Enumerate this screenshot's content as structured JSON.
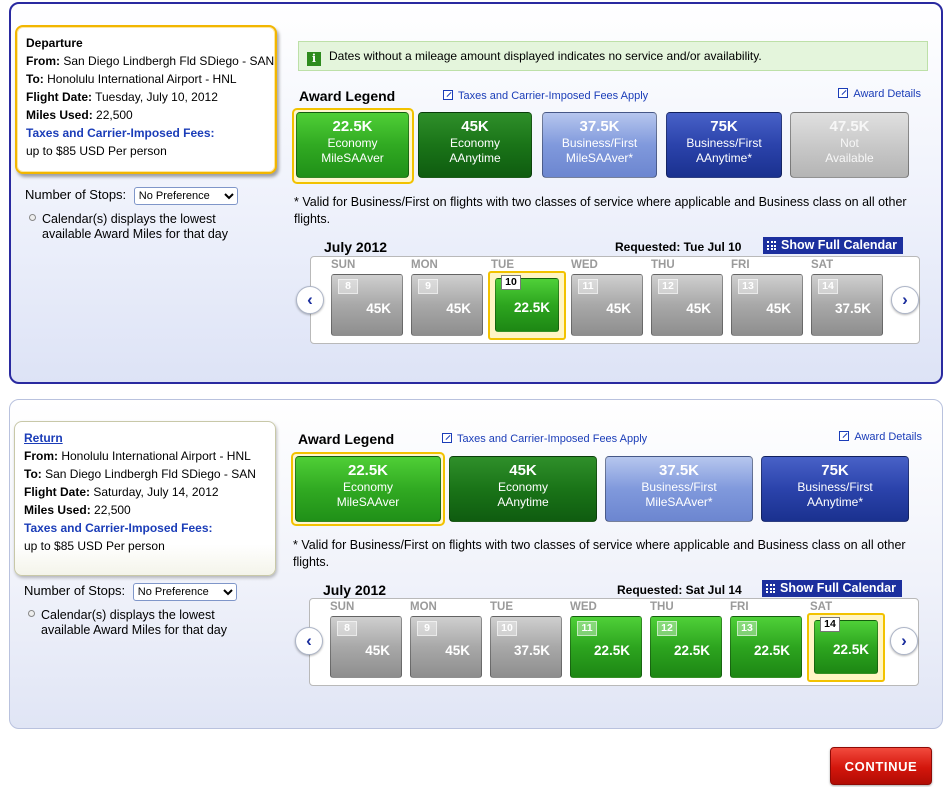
{
  "colors": {
    "section_border": "#2a2aa0",
    "selected_outline": "#f2c200",
    "economy_saver": "#31aa22",
    "economy_anytime": "#1a7418",
    "business_saver": "#8099dc",
    "business_anytime": "#2b43ab",
    "not_available": "#c9c9c9",
    "continue_button": "#d3160c",
    "link": "#1b3db8"
  },
  "departure": {
    "heading": "Departure",
    "from_label": "From:",
    "from_value": "San Diego Lindbergh Fld SDiego - SAN",
    "to_label": "To:",
    "to_value": "Honolulu International Airport - HNL",
    "date_label": "Flight Date:",
    "date_value": "Tuesday, July 10, 2012",
    "miles_label": "Miles Used:",
    "miles_value": "22,500",
    "fees_label": "Taxes and Carrier-Imposed Fees:",
    "fees_value": "up to $85 USD Per person",
    "stops_label": "Number of Stops:",
    "stops_value": "No Preference",
    "cal_note": "Calendar(s) displays the lowest available Award Miles for that day",
    "notice": "Dates without a mileage amount displayed indicates no service and/or availability.",
    "legend_title": "Award Legend",
    "fees_link": "Taxes and Carrier-Imposed Fees Apply",
    "award_details": "Award Details",
    "legend": [
      {
        "value": "22.5K",
        "l1": "Economy",
        "l2": "MileSAAver"
      },
      {
        "value": "45K",
        "l1": "Economy",
        "l2": "AAnytime"
      },
      {
        "value": "37.5K",
        "l1": "Business/First",
        "l2": "MileSAAver*"
      },
      {
        "value": "75K",
        "l1": "Business/First",
        "l2": "AAnytime*"
      },
      {
        "value": "47.5K",
        "l1": "Not",
        "l2": "Available"
      }
    ],
    "footnote": "* Valid for Business/First on flights with two classes of service where applicable and Business class on all other flights.",
    "month": "July 2012",
    "requested": "Requested: Tue Jul 10",
    "full_calendar": "Show Full Calendar",
    "days": [
      {
        "dow": "SUN",
        "num": "8",
        "miles": "45K"
      },
      {
        "dow": "MON",
        "num": "9",
        "miles": "45K"
      },
      {
        "dow": "TUE",
        "num": "10",
        "miles": "22.5K"
      },
      {
        "dow": "WED",
        "num": "11",
        "miles": "45K"
      },
      {
        "dow": "THU",
        "num": "12",
        "miles": "45K"
      },
      {
        "dow": "FRI",
        "num": "13",
        "miles": "45K"
      },
      {
        "dow": "SAT",
        "num": "14",
        "miles": "37.5K"
      }
    ]
  },
  "return": {
    "heading": "Return",
    "from_label": "From:",
    "from_value": "Honolulu International Airport - HNL",
    "to_label": "To:",
    "to_value": "San Diego Lindbergh Fld SDiego - SAN",
    "date_label": "Flight Date:",
    "date_value": "Saturday, July 14, 2012",
    "miles_label": "Miles Used:",
    "miles_value": "22,500",
    "fees_label": "Taxes and Carrier-Imposed Fees:",
    "fees_value": "up to $85 USD Per person",
    "stops_label": "Number of Stops:",
    "stops_value": "No Preference",
    "cal_note": "Calendar(s) displays the lowest available Award Miles for that day",
    "legend_title": "Award Legend",
    "fees_link": "Taxes and Carrier-Imposed Fees Apply",
    "award_details": "Award Details",
    "legend": [
      {
        "value": "22.5K",
        "l1": "Economy",
        "l2": "MileSAAver"
      },
      {
        "value": "45K",
        "l1": "Economy",
        "l2": "AAnytime"
      },
      {
        "value": "37.5K",
        "l1": "Business/First",
        "l2": "MileSAAver*"
      },
      {
        "value": "75K",
        "l1": "Business/First",
        "l2": "AAnytime*"
      }
    ],
    "footnote": "* Valid for Business/First on flights with two classes of service where applicable and Business class on all other flights.",
    "month": "July 2012",
    "requested": "Requested: Sat Jul 14",
    "full_calendar": "Show Full Calendar",
    "days": [
      {
        "dow": "SUN",
        "num": "8",
        "miles": "45K"
      },
      {
        "dow": "MON",
        "num": "9",
        "miles": "45K"
      },
      {
        "dow": "TUE",
        "num": "10",
        "miles": "37.5K"
      },
      {
        "dow": "WED",
        "num": "11",
        "miles": "22.5K"
      },
      {
        "dow": "THU",
        "num": "12",
        "miles": "22.5K"
      },
      {
        "dow": "FRI",
        "num": "13",
        "miles": "22.5K"
      },
      {
        "dow": "SAT",
        "num": "14",
        "miles": "22.5K"
      }
    ]
  },
  "continue_label": "CONTINUE"
}
